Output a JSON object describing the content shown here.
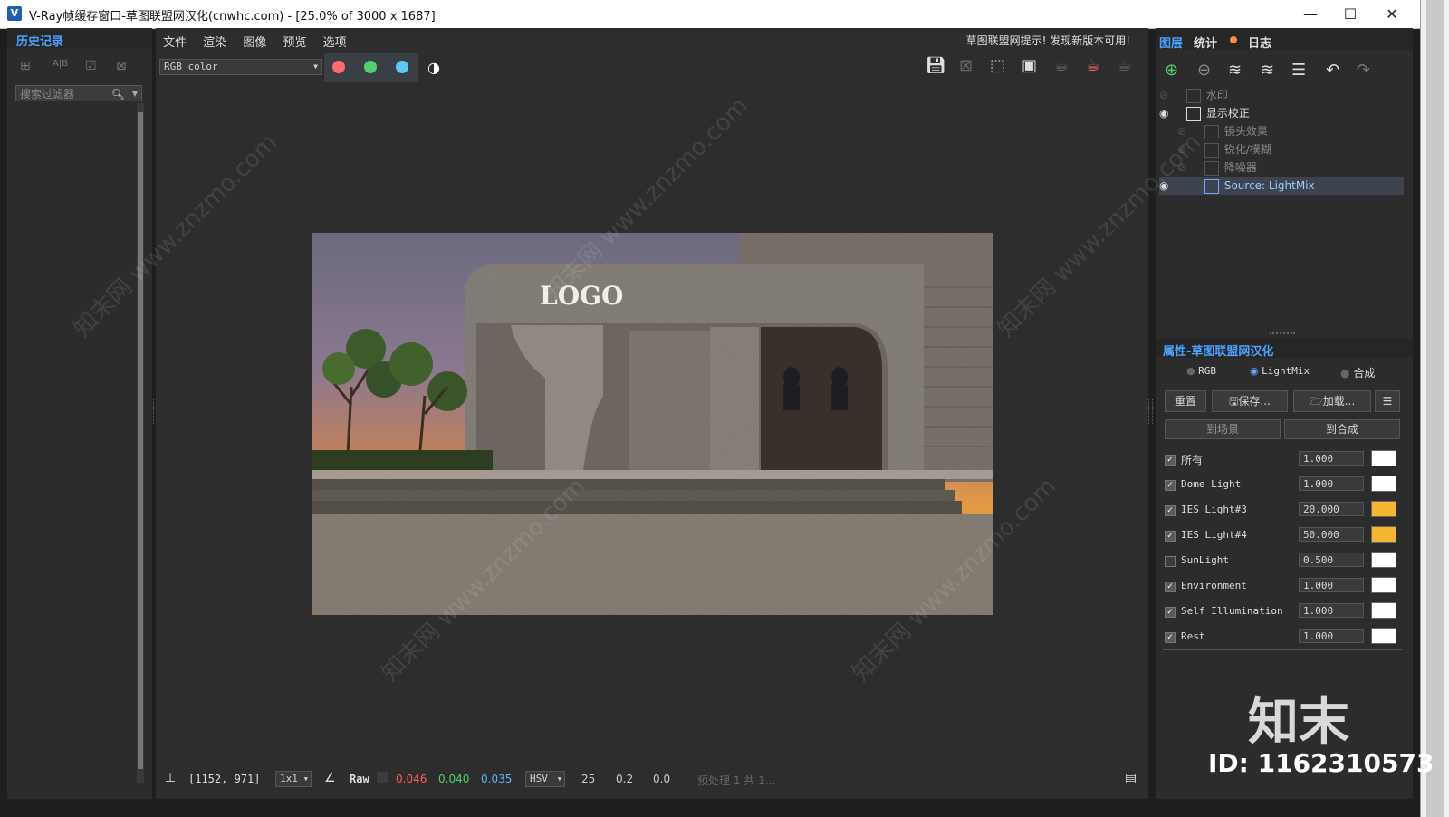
{
  "window": {
    "icon_letter": "V",
    "title": "V-Ray帧缓存窗口-草图联盟网汉化(cnwhc.com) - [25.0% of 3000 x 1687]",
    "minimize": "—",
    "maximize": "☐",
    "close": "✕"
  },
  "history": {
    "tab": "历史记录",
    "search_placeholder": "搜索过滤器"
  },
  "menu": {
    "items": [
      "文件",
      "渲染",
      "图像",
      "预览",
      "选项"
    ],
    "notice": "草图联盟网提示! 发现新版本可用!"
  },
  "toolbar": {
    "channel": "RGB color",
    "colors": {
      "red": "#ff6b6b",
      "green": "#4fd06a",
      "blue": "#5bc8f5"
    }
  },
  "render": {
    "logo_text": "LOGO"
  },
  "statusbar": {
    "coords": "[1152, 971]",
    "zoom": "1x1",
    "mode": "Raw",
    "r": "0.046",
    "g": "0.040",
    "b": "0.035",
    "color_space": "HSV",
    "h": "25",
    "s": "0.2",
    "v": "0.0",
    "progress_text": "预处理 1 共 1..."
  },
  "right_panel": {
    "tabs": [
      "图层",
      "统计",
      "日志"
    ],
    "tree": [
      {
        "label": "水印",
        "visible": false,
        "indent": 0
      },
      {
        "label": "显示校正",
        "visible": true,
        "indent": 0
      },
      {
        "label": "镜头效果",
        "visible": false,
        "indent": 1
      },
      {
        "label": "锐化/模糊",
        "visible": false,
        "indent": 1
      },
      {
        "label": "降噪器",
        "visible": false,
        "indent": 1
      },
      {
        "label": "Source: LightMix",
        "visible": true,
        "indent": 1,
        "selected": true
      }
    ],
    "props_title": "属性-草图联盟网汉化",
    "modes": [
      "RGB",
      "LightMix",
      "合成"
    ],
    "selected_mode": "LightMix",
    "buttons": {
      "reset": "重置",
      "save": "保存...",
      "load": "加载..."
    },
    "to_scene": "到场景",
    "to_comp": "到合成",
    "lightmix": [
      {
        "name": "所有",
        "value": "1.000",
        "color": "#ffffff",
        "checked": true
      },
      {
        "name": "Dome Light",
        "value": "1.000",
        "color": "#ffffff",
        "checked": true
      },
      {
        "name": "IES Light#3",
        "value": "20.000",
        "color": "#f5b731",
        "checked": true
      },
      {
        "name": "IES Light#4",
        "value": "50.000",
        "color": "#f5b731",
        "checked": true
      },
      {
        "name": "SunLight",
        "value": "0.500",
        "color": "#ffffff",
        "checked": false
      },
      {
        "name": "Environment",
        "value": "1.000",
        "color": "#ffffff",
        "checked": true
      },
      {
        "name": "Self Illumination",
        "value": "1.000",
        "color": "#ffffff",
        "checked": true
      },
      {
        "name": "Rest",
        "value": "1.000",
        "color": "#ffffff",
        "checked": true
      }
    ]
  },
  "watermark": {
    "site": "知末网 www.znzmo.com",
    "brand": "知末",
    "id_text": "ID: 1162310573"
  }
}
